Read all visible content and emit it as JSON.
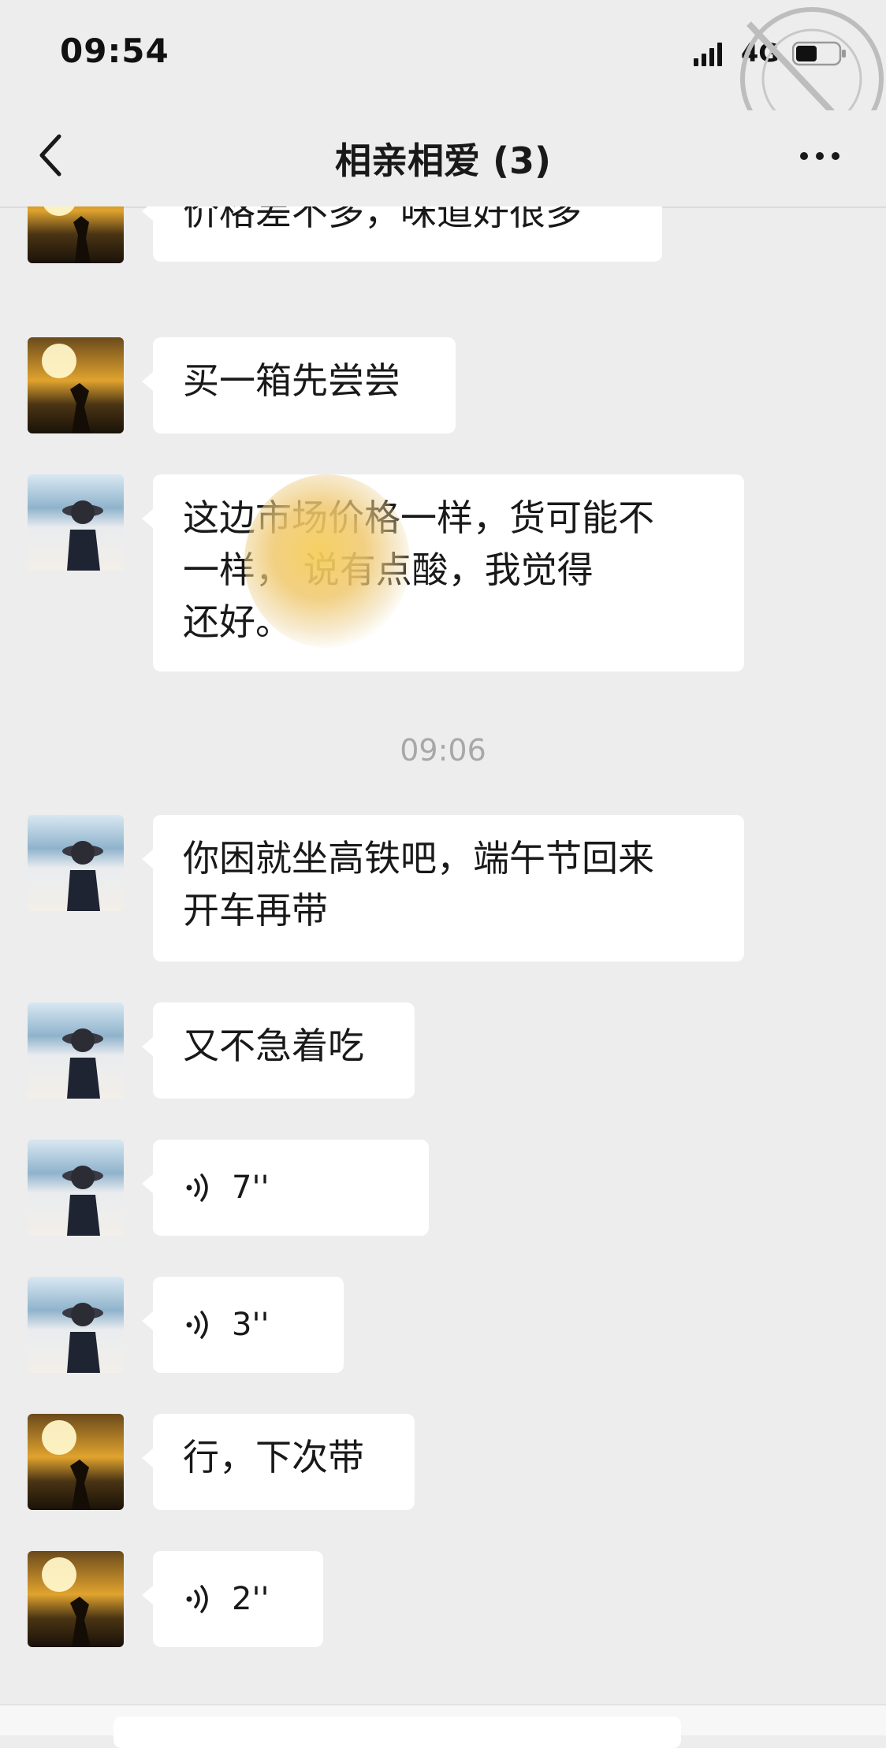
{
  "status_bar": {
    "time": "09:54",
    "network": "4G"
  },
  "nav": {
    "title": "相亲相爱 (3)",
    "back_icon": "chevron-left-icon",
    "more_icon": "more-dots-icon"
  },
  "messages": [
    {
      "sender": "sunset",
      "type": "text",
      "text": "价格差不多，味道好很多"
    },
    {
      "sender": "sunset",
      "type": "text",
      "text": "买一箱先尝尝"
    },
    {
      "sender": "beach",
      "type": "text",
      "lines": [
        "这边市场价格一样，货可能不",
        "一样，      说有点酸，我觉得",
        "还好。"
      ]
    },
    {
      "type": "time",
      "text": "09:06"
    },
    {
      "sender": "beach",
      "type": "text",
      "lines": [
        "你困就坐高铁吧，端午节回来",
        "开车再带"
      ]
    },
    {
      "sender": "beach",
      "type": "text",
      "text": "又不急着吃"
    },
    {
      "sender": "beach",
      "type": "voice",
      "duration": "7''"
    },
    {
      "sender": "beach",
      "type": "voice",
      "duration": "3''"
    },
    {
      "sender": "sunset",
      "type": "text",
      "text": "行，下次带"
    },
    {
      "sender": "sunset",
      "type": "voice",
      "duration": "2''"
    }
  ],
  "colors": {
    "background": "#ededed",
    "bubble": "#ffffff",
    "timestamp": "#a8a8a8"
  }
}
